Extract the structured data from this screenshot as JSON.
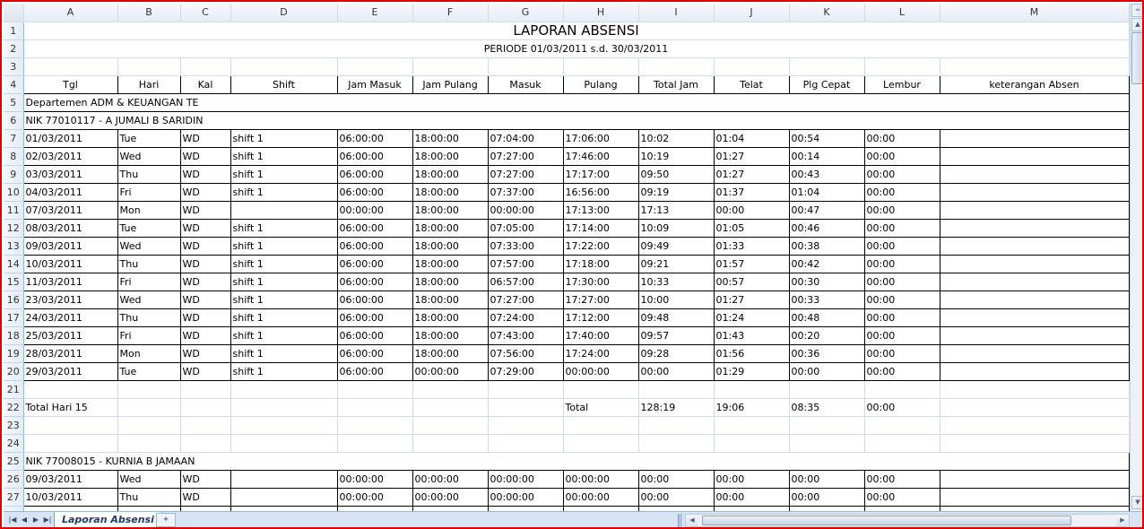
{
  "columns": [
    "A",
    "B",
    "C",
    "D",
    "E",
    "F",
    "G",
    "H",
    "I",
    "J",
    "K",
    "L",
    "M"
  ],
  "report": {
    "title": "LAPORAN ABSENSI",
    "period": "PERIODE 01/03/2011 s.d. 30/03/2011"
  },
  "headers": [
    "Tgl",
    "Hari",
    "Kal",
    "Shift",
    "Jam Masuk",
    "Jam Pulang",
    "Masuk",
    "Pulang",
    "Total Jam",
    "Telat",
    "Plg Cepat",
    "Lembur",
    "keterangan Absen"
  ],
  "department": "Departemen ADM & KEUANGAN TE",
  "employee1": {
    "nik": "NIK 77010117 - A JUMALI B SARIDIN",
    "rows": [
      [
        "01/03/2011",
        "Tue",
        "WD",
        "shift 1",
        "06:00:00",
        "18:00:00",
        "07:04:00",
        "17:06:00",
        "10:02",
        "01:04",
        "00:54",
        "00:00",
        ""
      ],
      [
        "02/03/2011",
        "Wed",
        "WD",
        "shift 1",
        "06:00:00",
        "18:00:00",
        "07:27:00",
        "17:46:00",
        "10:19",
        "01:27",
        "00:14",
        "00:00",
        ""
      ],
      [
        "03/03/2011",
        "Thu",
        "WD",
        "shift 1",
        "06:00:00",
        "18:00:00",
        "07:27:00",
        "17:17:00",
        "09:50",
        "01:27",
        "00:43",
        "00:00",
        ""
      ],
      [
        "04/03/2011",
        "Fri",
        "WD",
        "shift 1",
        "06:00:00",
        "18:00:00",
        "07:37:00",
        "16:56:00",
        "09:19",
        "01:37",
        "01:04",
        "00:00",
        ""
      ],
      [
        "07/03/2011",
        "Mon",
        "WD",
        "",
        "00:00:00",
        "18:00:00",
        "00:00:00",
        "17:13:00",
        "17:13",
        "00:00",
        "00:47",
        "00:00",
        ""
      ],
      [
        "08/03/2011",
        "Tue",
        "WD",
        "shift 1",
        "06:00:00",
        "18:00:00",
        "07:05:00",
        "17:14:00",
        "10:09",
        "01:05",
        "00:46",
        "00:00",
        ""
      ],
      [
        "09/03/2011",
        "Wed",
        "WD",
        "shift 1",
        "06:00:00",
        "18:00:00",
        "07:33:00",
        "17:22:00",
        "09:49",
        "01:33",
        "00:38",
        "00:00",
        ""
      ],
      [
        "10/03/2011",
        "Thu",
        "WD",
        "shift 1",
        "06:00:00",
        "18:00:00",
        "07:57:00",
        "17:18:00",
        "09:21",
        "01:57",
        "00:42",
        "00:00",
        ""
      ],
      [
        "11/03/2011",
        "Fri",
        "WD",
        "shift 1",
        "06:00:00",
        "18:00:00",
        "06:57:00",
        "17:30:00",
        "10:33",
        "00:57",
        "00:30",
        "00:00",
        ""
      ],
      [
        "23/03/2011",
        "Wed",
        "WD",
        "shift 1",
        "06:00:00",
        "18:00:00",
        "07:27:00",
        "17:27:00",
        "10:00",
        "01:27",
        "00:33",
        "00:00",
        ""
      ],
      [
        "24/03/2011",
        "Thu",
        "WD",
        "shift 1",
        "06:00:00",
        "18:00:00",
        "07:24:00",
        "17:12:00",
        "09:48",
        "01:24",
        "00:48",
        "00:00",
        ""
      ],
      [
        "25/03/2011",
        "Fri",
        "WD",
        "shift 1",
        "06:00:00",
        "18:00:00",
        "07:43:00",
        "17:40:00",
        "09:57",
        "01:43",
        "00:20",
        "00:00",
        ""
      ],
      [
        "28/03/2011",
        "Mon",
        "WD",
        "shift 1",
        "06:00:00",
        "18:00:00",
        "07:56:00",
        "17:24:00",
        "09:28",
        "01:56",
        "00:36",
        "00:00",
        ""
      ],
      [
        "29/03/2011",
        "Tue",
        "WD",
        "shift 1",
        "06:00:00",
        "00:00:00",
        "07:29:00",
        "00:00:00",
        "00:00",
        "01:29",
        "00:00",
        "00:00",
        ""
      ]
    ],
    "total_label": "Total Hari 15",
    "total_word": "Total",
    "total_jam": "128:19",
    "total_telat": "19:06",
    "total_plg_cepat": "08:35",
    "total_lembur": "00:00"
  },
  "employee2": {
    "nik": "NIK 77008015 - KURNIA B JAMAAN",
    "rows": [
      [
        "09/03/2011",
        "Wed",
        "WD",
        "",
        "00:00:00",
        "00:00:00",
        "00:00:00",
        "00:00:00",
        "00:00",
        "00:00",
        "00:00",
        "00:00",
        ""
      ],
      [
        "10/03/2011",
        "Thu",
        "WD",
        "",
        "00:00:00",
        "00:00:00",
        "00:00:00",
        "00:00:00",
        "00:00",
        "00:00",
        "00:00",
        "00:00",
        ""
      ]
    ]
  },
  "sheet_tab": "Laporan Absensi",
  "colors": {
    "frame_border": "#e00000",
    "header_bg": "#e4ecf7",
    "grid_line": "#d4dbe6"
  }
}
